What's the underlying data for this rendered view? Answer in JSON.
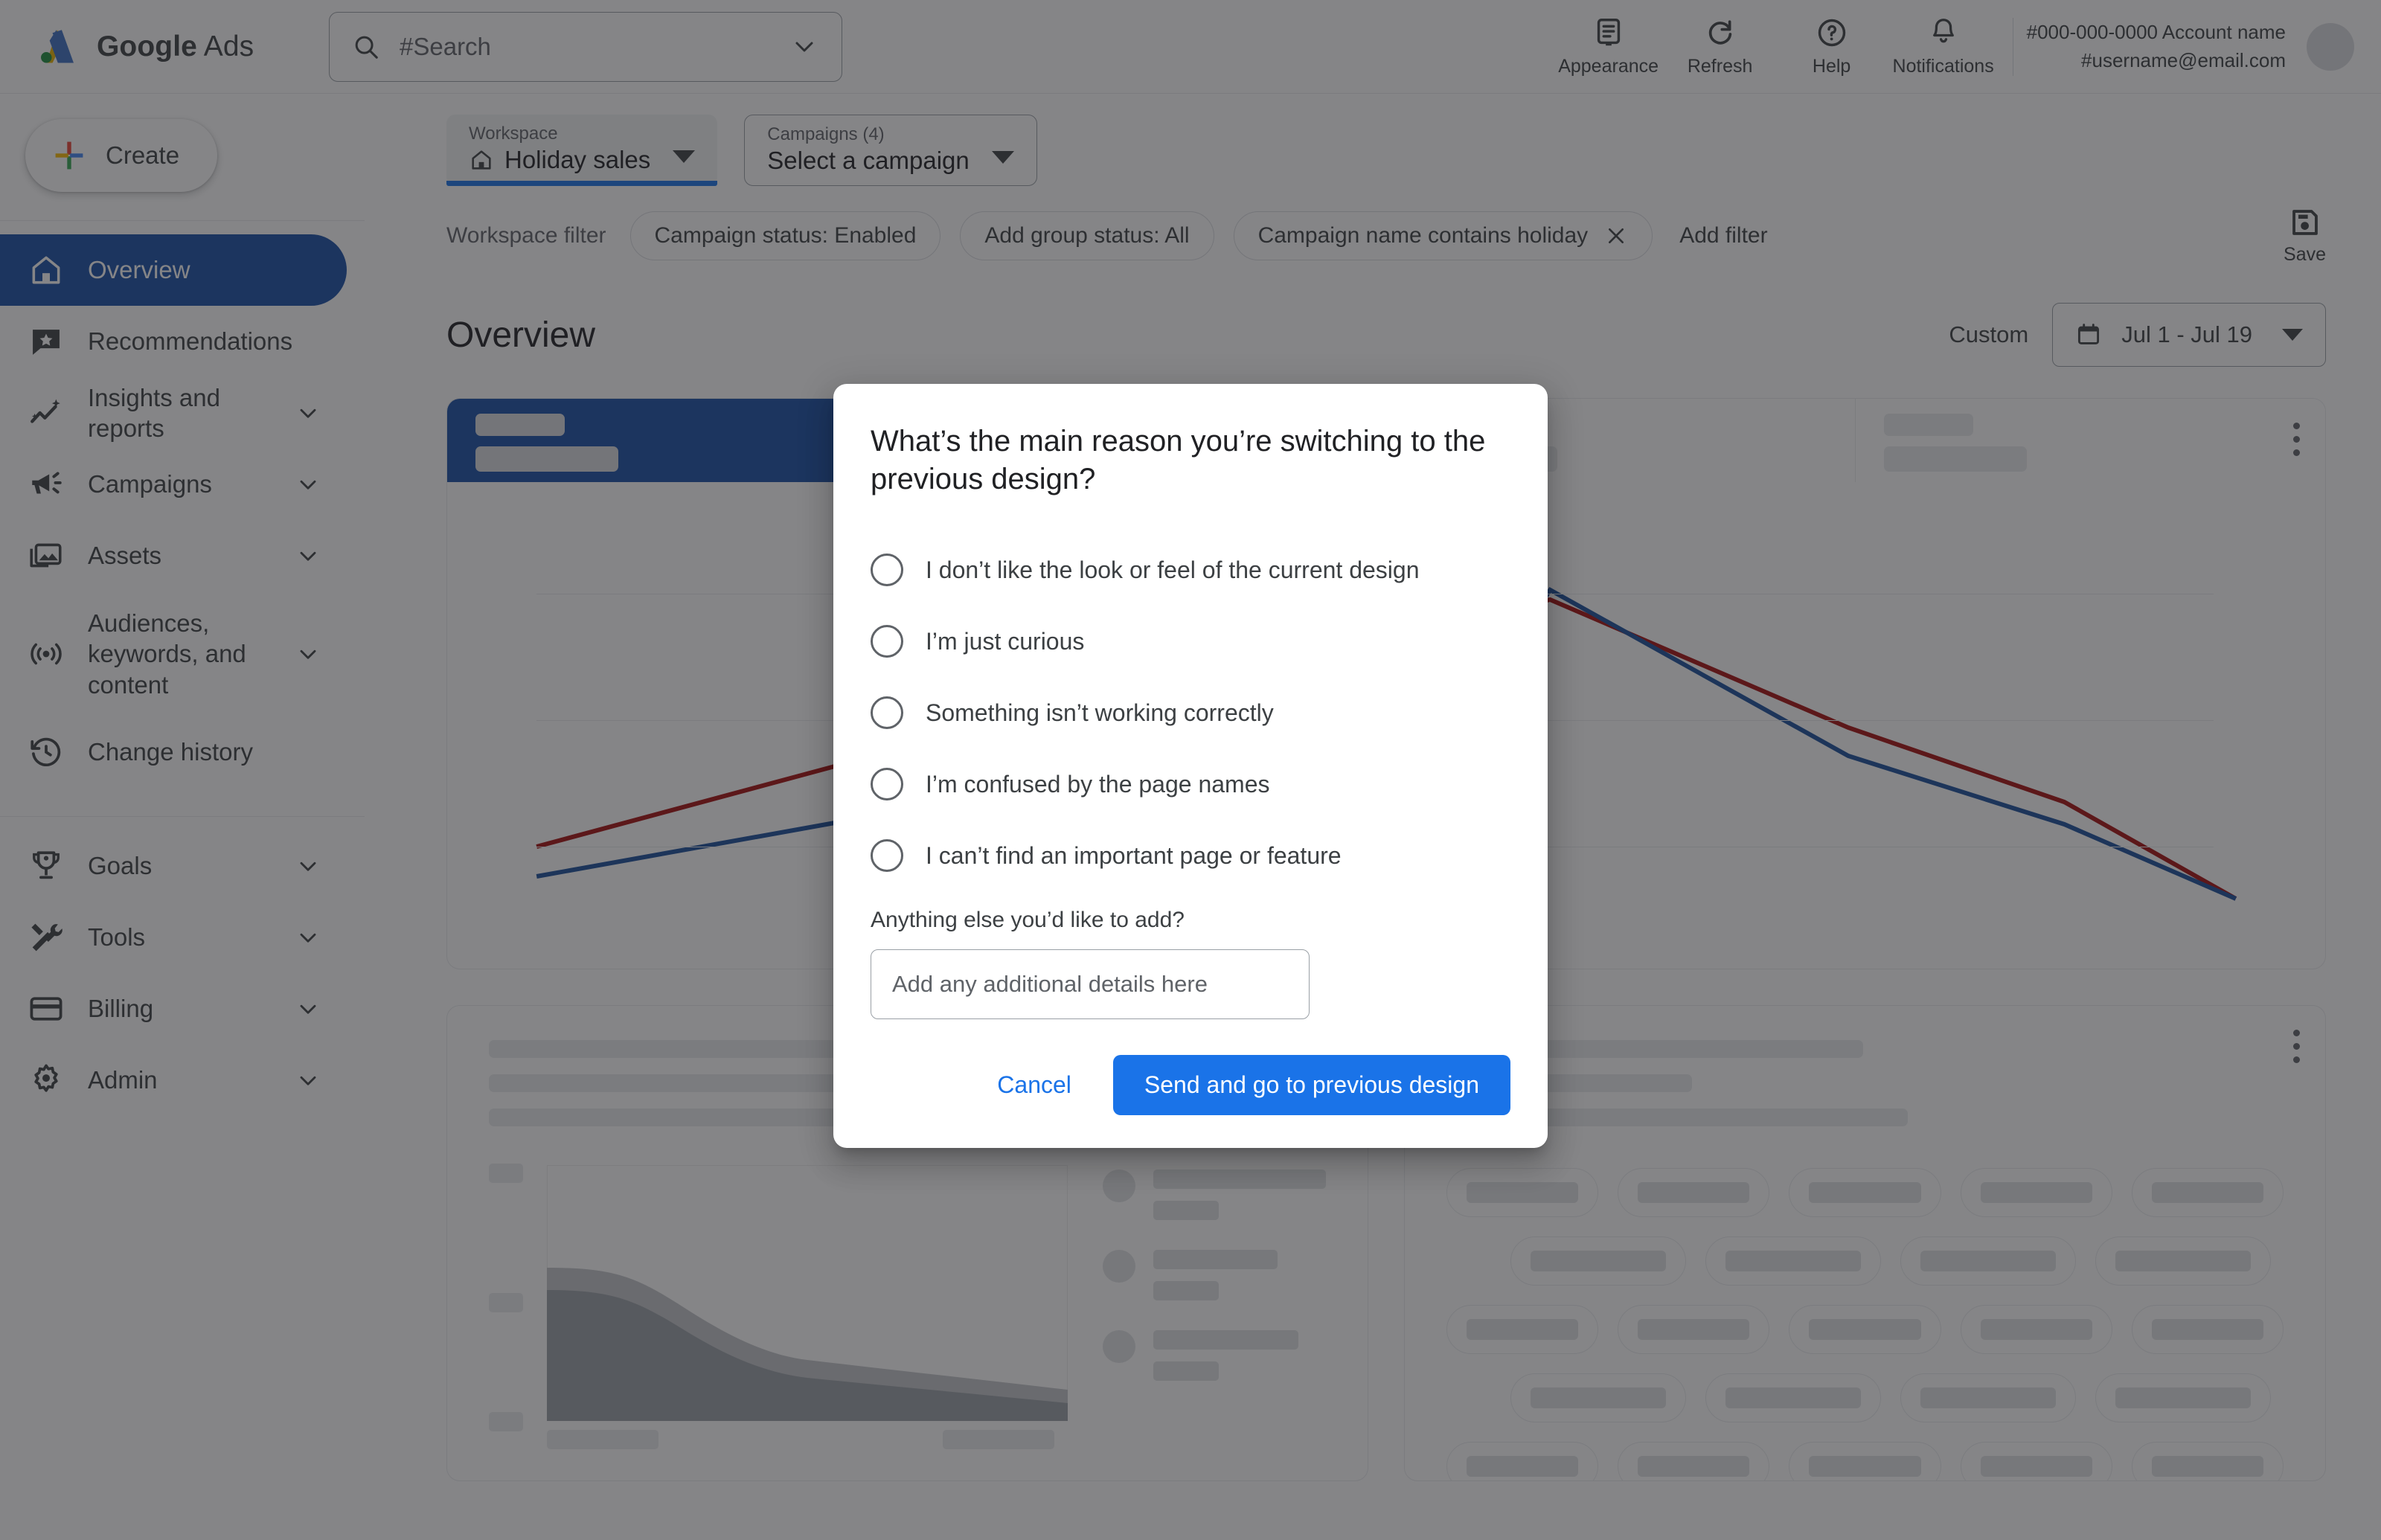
{
  "app": {
    "brand_google": "Google",
    "brand_product": "Ads"
  },
  "search": {
    "placeholder": "#Search",
    "icon": "search-icon"
  },
  "topbar": {
    "actions": [
      {
        "label": "Appearance",
        "icon": "appearance-icon"
      },
      {
        "label": "Refresh",
        "icon": "refresh-icon"
      },
      {
        "label": "Help",
        "icon": "help-icon"
      },
      {
        "label": "Notifications",
        "icon": "bell-icon"
      }
    ],
    "account_id": "#000-000-0000 Account name",
    "account_email": "#username@email.com"
  },
  "sidebar": {
    "create_label": "Create",
    "items": [
      {
        "label": "Overview",
        "icon": "home-icon",
        "active": true,
        "expandable": false
      },
      {
        "label": "Recommendations",
        "icon": "recommendation-star-icon",
        "active": false,
        "expandable": false
      },
      {
        "label": "Insights and reports",
        "icon": "insights-sparkle-icon",
        "active": false,
        "expandable": true
      },
      {
        "label": "Campaigns",
        "icon": "megaphone-icon",
        "active": false,
        "expandable": true
      },
      {
        "label": "Assets",
        "icon": "assets-image-icon",
        "active": false,
        "expandable": true
      },
      {
        "label": "Audiences, keywords, and content",
        "icon": "audience-signal-icon",
        "active": false,
        "expandable": true
      },
      {
        "label": "Change history",
        "icon": "history-clock-icon",
        "active": false,
        "expandable": false
      }
    ],
    "items_lower": [
      {
        "label": "Goals",
        "icon": "trophy-icon",
        "expandable": true
      },
      {
        "label": "Tools",
        "icon": "tools-icon",
        "expandable": true
      },
      {
        "label": "Billing",
        "icon": "credit-card-icon",
        "expandable": true
      },
      {
        "label": "Admin",
        "icon": "gear-icon",
        "expandable": true
      }
    ]
  },
  "toolbar": {
    "workspace": {
      "caption": "Workspace",
      "value": "Holiday sales",
      "icon": "home-icon",
      "dropdown_icon": "caret-down-icon"
    },
    "campaigns": {
      "caption": "Campaigns (4)",
      "value": "Select a campaign",
      "dropdown_icon": "caret-down-icon"
    }
  },
  "filters": {
    "label": "Workspace filter",
    "chips": [
      {
        "text": "Campaign status: Enabled",
        "removable": false
      },
      {
        "text": "Add group status: All",
        "removable": false
      },
      {
        "text": "Campaign name contains holiday",
        "removable": true
      }
    ],
    "add_filter": "Add filter",
    "save": {
      "label": "Save",
      "icon": "save-disk-icon"
    }
  },
  "page": {
    "title": "Overview",
    "date_range": {
      "preset_label": "Custom",
      "value": "Jul 1 - Jul 19",
      "icon": "calendar-icon",
      "dropdown_icon": "caret-down-icon"
    }
  },
  "dialog": {
    "title": "What’s the main reason you’re switching to the previous design?",
    "options": [
      "I don’t like the look or feel of the current design",
      "I’m just curious",
      "Something isn’t working correctly",
      "I’m confused by the page names",
      "I can’t find an important page or feature"
    ],
    "selected_index": null,
    "followup_label": "Anything else you’d like to add?",
    "textarea_placeholder": "Add any additional details here",
    "textarea_value": "",
    "cancel_label": "Cancel",
    "submit_label": "Send and go to previous design",
    "accent_color": "#1a73e8"
  },
  "chart_data": [
    {
      "type": "line",
      "title": "",
      "x": [
        0,
        1,
        2,
        3,
        4,
        5,
        6,
        7
      ],
      "series": [
        {
          "name": "series-red",
          "color": "#a50e0e",
          "values": [
            26,
            40,
            52,
            62,
            78,
            58,
            38,
            14
          ]
        },
        {
          "name": "series-blue",
          "color": "#1a4f9c",
          "values": [
            18,
            30,
            42,
            50,
            82,
            50,
            30,
            14
          ]
        }
      ],
      "grid": true,
      "gridlines_y": [
        80,
        55,
        30,
        14
      ],
      "ylim": [
        0,
        100
      ],
      "legend": "none",
      "xlabel": "",
      "ylabel": ""
    },
    {
      "type": "area",
      "title": "",
      "x": [
        0,
        1,
        2,
        3,
        4
      ],
      "series": [
        {
          "name": "area-upper",
          "color": "#bdc1c6",
          "values": [
            72,
            70,
            48,
            36,
            30
          ]
        },
        {
          "name": "area-lower",
          "color": "#9aa0a6",
          "values": [
            62,
            60,
            40,
            30,
            26
          ]
        }
      ],
      "grid": false,
      "ylim": [
        0,
        100
      ],
      "legend": "right-list",
      "xlabel": "",
      "ylabel": ""
    }
  ],
  "colors": {
    "accent_blue": "#1a73e8",
    "nav_active": "#174ea6",
    "scorecard_blue": "#174ea6",
    "scorecard_red": "#a50e0e",
    "chart_red": "#a50e0e",
    "chart_blue": "#1a4f9c",
    "text_primary": "#202124",
    "text_secondary": "#5f6368"
  }
}
